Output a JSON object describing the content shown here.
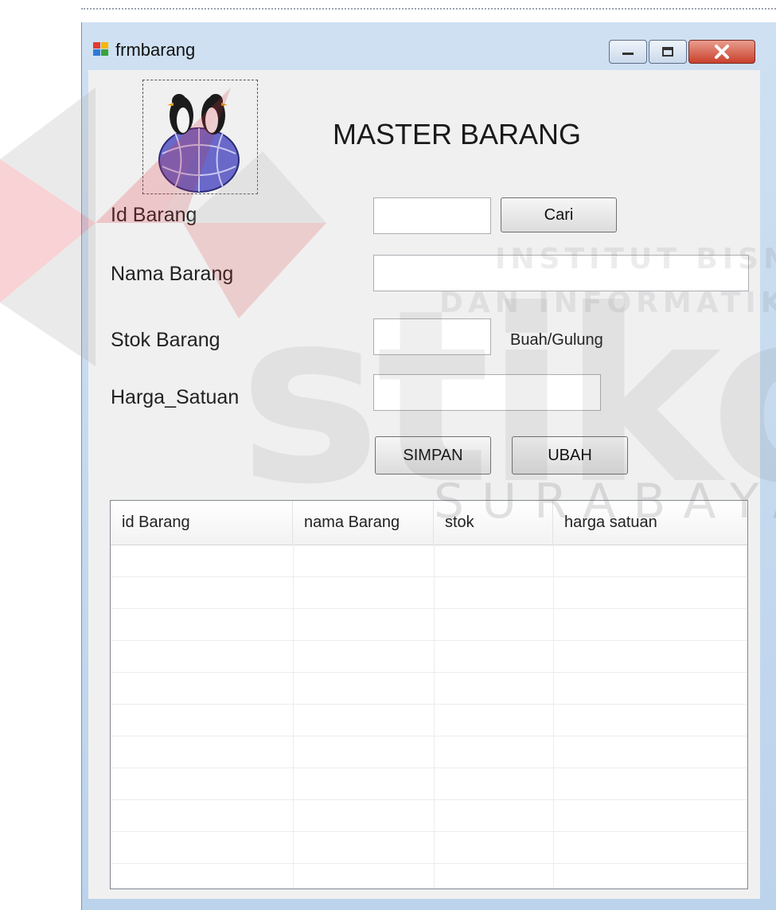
{
  "window": {
    "title": "frmbarang"
  },
  "header": {
    "title": "MASTER BARANG"
  },
  "form": {
    "id_label": "Id Barang",
    "id_value": "",
    "search_button": "Cari",
    "nama_label": "Nama Barang",
    "nama_value": "",
    "stok_label": "Stok Barang",
    "stok_value": "",
    "stok_unit": "Buah/Gulung",
    "harga_label": "Harga_Satuan",
    "harga_value": "",
    "save_button": "SIMPAN",
    "edit_button": "UBAH"
  },
  "grid": {
    "columns": [
      "id Barang",
      "nama Barang",
      "stok",
      "harga satuan"
    ],
    "rows": []
  },
  "watermark": {
    "line1": "INSTITUT BISNIS",
    "line2": "DAN INFORMATIKA",
    "brand": "stikom",
    "city": "SURABAYA"
  },
  "colors": {
    "frame": "#bcd3ec",
    "client": "#f0f0f0",
    "close_button": "#c9402b",
    "logo_red": "#e0303a"
  },
  "icons": [
    "app-form-icon",
    "minimize-icon",
    "maximize-icon",
    "close-icon",
    "penguin-globe-logo"
  ]
}
